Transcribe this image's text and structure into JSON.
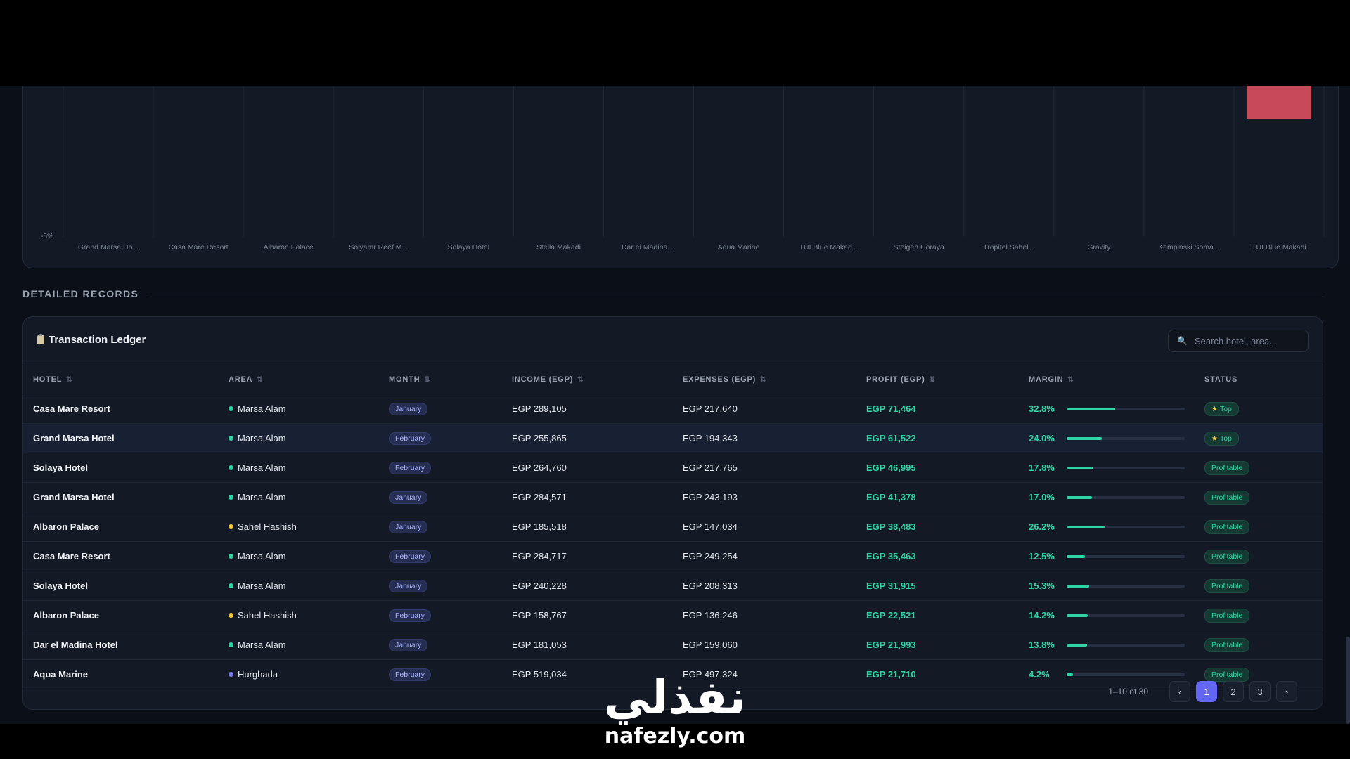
{
  "chart_data": {
    "type": "bar",
    "categories": [
      "Grand Marsa Ho...",
      "Casa Mare Resort",
      "Albaron Palace",
      "Solyamr Reef M...",
      "Solaya Hotel",
      "Stella Makadi",
      "Dar el Madina ...",
      "Aqua Marine",
      "TUI Blue Makad...",
      "Steigen Coraya",
      "Tropitel Sahel...",
      "Gravity",
      "Kempinski Soma...",
      "TUI Blue Makadi"
    ],
    "y_tick_label": "-5%",
    "negative_color": "#c84a5a"
  },
  "section": {
    "title": "DETAILED RECORDS"
  },
  "ledger": {
    "title": "Transaction Ledger",
    "search_placeholder": "Search hotel, area...",
    "columns": [
      "HOTEL",
      "AREA",
      "MONTH",
      "INCOME (EGP)",
      "EXPENSES (EGP)",
      "PROFIT (EGP)",
      "MARGIN",
      "STATUS"
    ],
    "rows": [
      {
        "hotel": "Casa Mare Resort",
        "area": "Marsa Alam",
        "month": "January",
        "income": "EGP 289,105",
        "expenses": "EGP 217,640",
        "profit": "EGP 71,464",
        "margin": "32.8%",
        "margin_pct": 32.8,
        "status": "Top"
      },
      {
        "hotel": "Grand Marsa Hotel",
        "area": "Marsa Alam",
        "month": "February",
        "income": "EGP 255,865",
        "expenses": "EGP 194,343",
        "profit": "EGP 61,522",
        "margin": "24.0%",
        "margin_pct": 24.0,
        "status": "Top"
      },
      {
        "hotel": "Solaya Hotel",
        "area": "Marsa Alam",
        "month": "February",
        "income": "EGP 264,760",
        "expenses": "EGP 217,765",
        "profit": "EGP 46,995",
        "margin": "17.8%",
        "margin_pct": 17.8,
        "status": "Profitable"
      },
      {
        "hotel": "Grand Marsa Hotel",
        "area": "Marsa Alam",
        "month": "January",
        "income": "EGP 284,571",
        "expenses": "EGP 243,193",
        "profit": "EGP 41,378",
        "margin": "17.0%",
        "margin_pct": 17.0,
        "status": "Profitable"
      },
      {
        "hotel": "Albaron Palace",
        "area": "Sahel Hashish",
        "month": "January",
        "income": "EGP 185,518",
        "expenses": "EGP 147,034",
        "profit": "EGP 38,483",
        "margin": "26.2%",
        "margin_pct": 26.2,
        "status": "Profitable"
      },
      {
        "hotel": "Casa Mare Resort",
        "area": "Marsa Alam",
        "month": "February",
        "income": "EGP 284,717",
        "expenses": "EGP 249,254",
        "profit": "EGP 35,463",
        "margin": "12.5%",
        "margin_pct": 12.5,
        "status": "Profitable"
      },
      {
        "hotel": "Solaya Hotel",
        "area": "Marsa Alam",
        "month": "January",
        "income": "EGP 240,228",
        "expenses": "EGP 208,313",
        "profit": "EGP 31,915",
        "margin": "15.3%",
        "margin_pct": 15.3,
        "status": "Profitable"
      },
      {
        "hotel": "Albaron Palace",
        "area": "Sahel Hashish",
        "month": "February",
        "income": "EGP 158,767",
        "expenses": "EGP 136,246",
        "profit": "EGP 22,521",
        "margin": "14.2%",
        "margin_pct": 14.2,
        "status": "Profitable"
      },
      {
        "hotel": "Dar el Madina Hotel",
        "area": "Marsa Alam",
        "month": "January",
        "income": "EGP 181,053",
        "expenses": "EGP 159,060",
        "profit": "EGP 21,993",
        "margin": "13.8%",
        "margin_pct": 13.8,
        "status": "Profitable"
      },
      {
        "hotel": "Aqua Marine",
        "area": "Hurghada",
        "month": "February",
        "income": "EGP 519,034",
        "expenses": "EGP 497,324",
        "profit": "EGP 21,710",
        "margin": "4.2%",
        "margin_pct": 4.2,
        "status": "Profitable"
      }
    ],
    "area_colors": {
      "Marsa Alam": "#2fd3a4",
      "Sahel Hashish": "#f5c742",
      "Hurghada": "#7c7cf5"
    },
    "pager": {
      "info": "1–10 of 30",
      "prev": "‹",
      "next": "›",
      "pages": [
        "1",
        "2",
        "3"
      ],
      "active": "1"
    }
  },
  "watermark": {
    "logo": "نفذلي",
    "url": "nafezly.com"
  }
}
